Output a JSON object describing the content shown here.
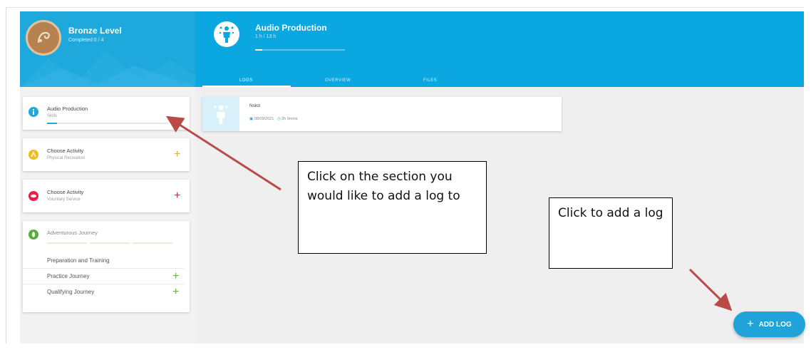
{
  "level": {
    "title": "Bronze Level",
    "subtitle": "Completed 0 / 4"
  },
  "course": {
    "title": "Audio Production",
    "subtitle": "1 h / 13 h",
    "progress": 0.08
  },
  "tabs": [
    {
      "label": "LOGS",
      "active": true
    },
    {
      "label": "OVERVIEW",
      "active": false
    },
    {
      "label": "FILES",
      "active": false
    }
  ],
  "sidebar": {
    "items": [
      {
        "title": "Audio Production",
        "subtitle": "Skills",
        "icon": "info-icon",
        "color": "#1ea8dc",
        "progress": 0.08,
        "selected": true
      },
      {
        "title": "Choose Activity",
        "subtitle": "Physical Recreation",
        "icon": "physical-icon",
        "color": "#f1bd1e",
        "plus_color": "#e9b318"
      },
      {
        "title": "Choose Activity",
        "subtitle": "Voluntary Service",
        "icon": "service-icon",
        "color": "#e8213f",
        "plus_color": "#e8213f"
      },
      {
        "title": "Adventurous Journey",
        "icon": "journey-icon",
        "color": "#5aac3a",
        "sub_items": [
          {
            "label": "Preparation and Training",
            "has_plus": false
          },
          {
            "label": "Practice Journey",
            "has_plus": true
          },
          {
            "label": "Qualifying Journey",
            "has_plus": true
          }
        ],
        "plus_color": "#6db33f"
      }
    ]
  },
  "log": {
    "name": "Nskd",
    "date": "08/09/2021",
    "duration": "2h 0mins"
  },
  "annotations": {
    "section_note": "Click on the section you would like to add a log to",
    "add_note": "Click to add a log"
  },
  "fab": {
    "label": "ADD LOG",
    "icon": "plus-icon"
  },
  "colors": {
    "header_blue": "#0aa7e0",
    "arrow_red": "#b94a48",
    "fab_blue": "#1fa3d8"
  }
}
